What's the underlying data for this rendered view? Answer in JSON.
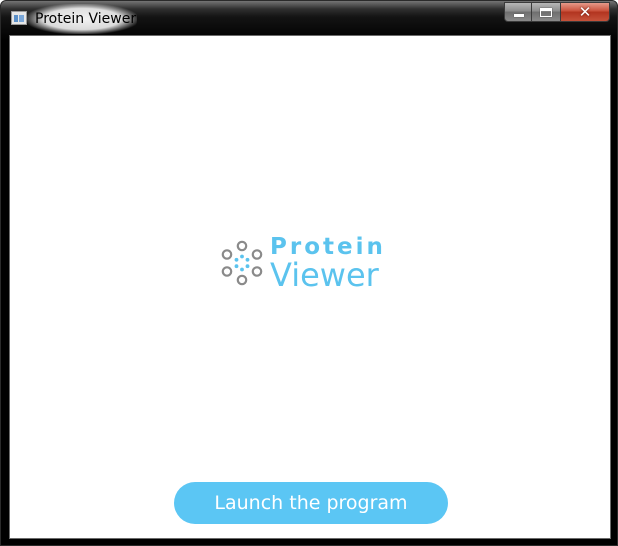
{
  "window": {
    "title": "Protein Viewer",
    "controls": {
      "minimize_icon": "minimize-icon",
      "maximize_icon": "maximize-icon",
      "close_icon": "close-icon",
      "close_glyph": "✕"
    }
  },
  "logo": {
    "word_1": "Protein",
    "word_2": "Viewer",
    "mark_icon": "molecule-ring-icon"
  },
  "actions": {
    "launch_label": "Launch the program"
  },
  "colors": {
    "accent": "#5bc6f4",
    "logo_text": "#5bc3ee",
    "logo_mark_outer": "#8a8a8a",
    "logo_mark_inner": "#5bc3ee",
    "close_button": "#c9503a"
  }
}
